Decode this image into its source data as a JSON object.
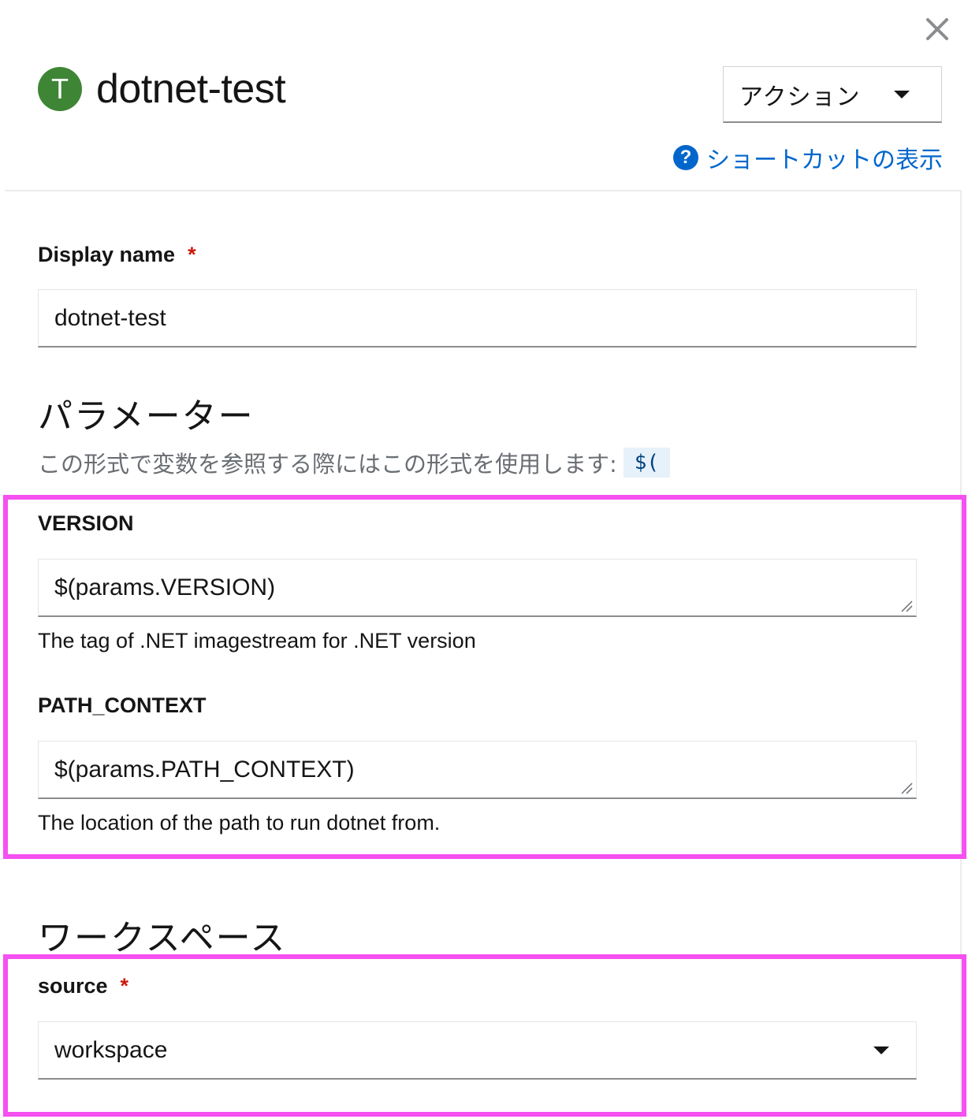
{
  "panel": {
    "close_icon": "close-icon",
    "badge_letter": "T",
    "title": "dotnet-test",
    "actions_label": "アクション",
    "shortcuts_label": "ショートカットの表示",
    "help_icon": "question-circle-icon"
  },
  "display_name": {
    "label": "Display name",
    "required": "*",
    "value": "dotnet-test"
  },
  "parameters": {
    "heading": "パラメーター",
    "description": "この形式で変数を参照する際にはこの形式を使用します:",
    "code_snippet": "$(",
    "fields": [
      {
        "label": "VERSION",
        "value": "$(params.VERSION)",
        "helper": "The tag of .NET imagestream for .NET version"
      },
      {
        "label": "PATH_CONTEXT",
        "value": "$(params.PATH_CONTEXT)",
        "helper": "The location of the path to run dotnet from."
      }
    ]
  },
  "workspaces": {
    "heading": "ワークスペース",
    "fields": [
      {
        "label": "source",
        "required": "*",
        "value": "workspace"
      }
    ]
  },
  "colors": {
    "badge": "#3e8635",
    "link": "#0066cc",
    "required": "#c9190b",
    "highlight": "#f550f0",
    "code_chip_bg": "#e7f1fa"
  }
}
